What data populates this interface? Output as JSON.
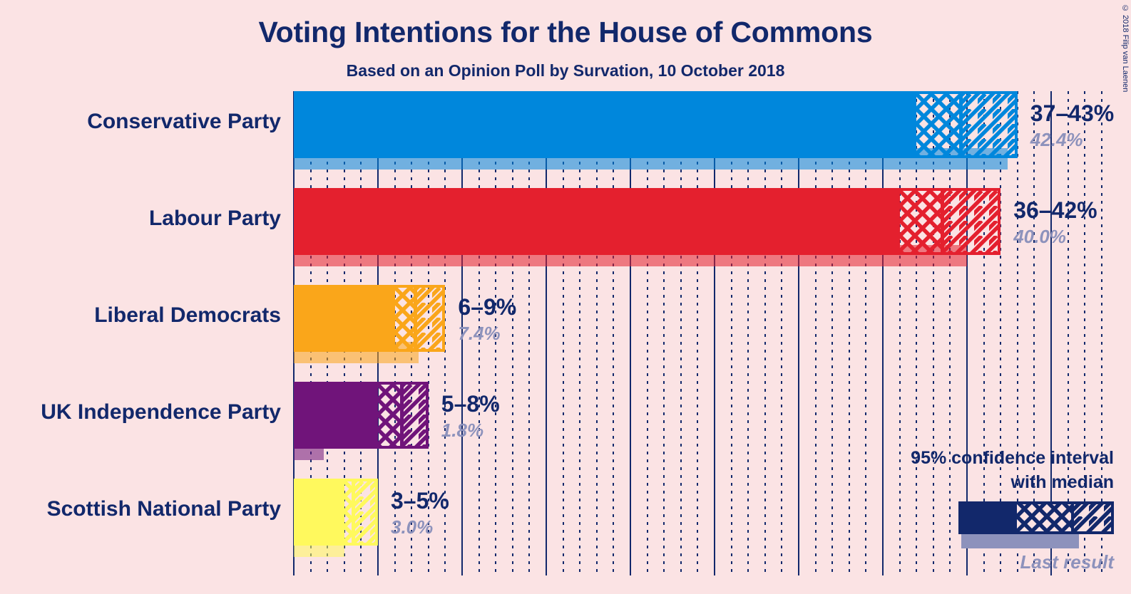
{
  "header": {
    "title": "Voting Intentions for the House of Commons",
    "subtitle": "Based on an Opinion Poll by Survation, 10 October 2018",
    "copyright": "© 2018 Filip van Laenen"
  },
  "legend": {
    "line1": "95% confidence interval",
    "line2": "with median",
    "caption": "Last result"
  },
  "colors": {
    "background": "#FBE3E4",
    "ink": "#12286B",
    "muted": "#8D92BC",
    "conservative": "#0087DC",
    "labour": "#E4202E",
    "libdem": "#FAA61A",
    "ukip": "#70147A",
    "snp": "#FFF95D"
  },
  "chart_data": {
    "type": "bar",
    "title": "Voting Intentions for the House of Commons",
    "subtitle": "Based on an Opinion Poll by Survation, 10 October 2018",
    "xlabel": "",
    "ylabel": "",
    "xlim": [
      0,
      48
    ],
    "grid": true,
    "grid_major_step": 5,
    "grid_minor_step": 1,
    "legend_position": "bottom-right",
    "categories": [
      "Conservative Party",
      "Labour Party",
      "Liberal Democrats",
      "UK Independence Party",
      "Scottish National Party"
    ],
    "series": [
      {
        "name": "95% confidence interval with median",
        "intervals": [
          {
            "low": 37.0,
            "median": 39.6,
            "high": 43.0
          },
          {
            "low": 36.0,
            "median": 38.5,
            "high": 42.0
          },
          {
            "low": 6.0,
            "median": 7.2,
            "high": 9.0
          },
          {
            "low": 5.0,
            "median": 6.4,
            "high": 8.0
          },
          {
            "low": 3.0,
            "median": 3.5,
            "high": 5.0
          }
        ]
      },
      {
        "name": "Last result",
        "values": [
          42.4,
          40.0,
          7.4,
          1.8,
          3.0
        ]
      }
    ],
    "rows": [
      {
        "party": "Conservative Party",
        "color": "#0087DC",
        "range_label": "37–43%",
        "last_label": "42.4%",
        "low": 37.0,
        "median": 39.6,
        "high": 43.0,
        "last": 42.4
      },
      {
        "party": "Labour Party",
        "color": "#E4202E",
        "range_label": "36–42%",
        "last_label": "40.0%",
        "low": 36.0,
        "median": 38.5,
        "high": 42.0,
        "last": 40.0
      },
      {
        "party": "Liberal Democrats",
        "color": "#FAA61A",
        "range_label": "6–9%",
        "last_label": "7.4%",
        "low": 6.0,
        "median": 7.2,
        "high": 9.0,
        "last": 7.4
      },
      {
        "party": "UK Independence Party",
        "color": "#70147A",
        "range_label": "5–8%",
        "last_label": "1.8%",
        "low": 5.0,
        "median": 6.4,
        "high": 8.0,
        "last": 1.8
      },
      {
        "party": "Scottish National Party",
        "color": "#FFF95D",
        "range_label": "3–5%",
        "last_label": "3.0%",
        "low": 3.0,
        "median": 3.5,
        "high": 5.0,
        "last": 3.0
      }
    ]
  }
}
